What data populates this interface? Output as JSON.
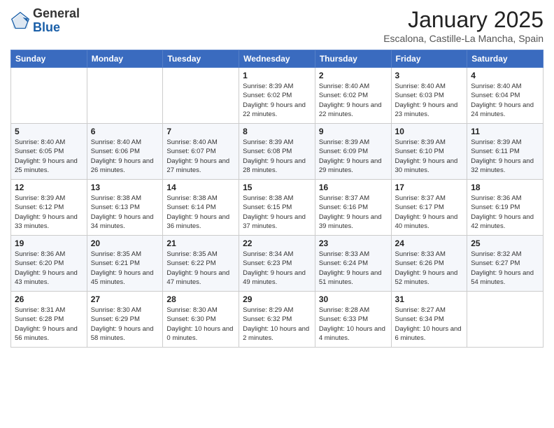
{
  "header": {
    "logo_general": "General",
    "logo_blue": "Blue",
    "month": "January 2025",
    "location": "Escalona, Castille-La Mancha, Spain"
  },
  "weekdays": [
    "Sunday",
    "Monday",
    "Tuesday",
    "Wednesday",
    "Thursday",
    "Friday",
    "Saturday"
  ],
  "weeks": [
    [
      {
        "day": "",
        "sunrise": "",
        "sunset": "",
        "daylight": ""
      },
      {
        "day": "",
        "sunrise": "",
        "sunset": "",
        "daylight": ""
      },
      {
        "day": "",
        "sunrise": "",
        "sunset": "",
        "daylight": ""
      },
      {
        "day": "1",
        "sunrise": "Sunrise: 8:39 AM",
        "sunset": "Sunset: 6:02 PM",
        "daylight": "Daylight: 9 hours and 22 minutes."
      },
      {
        "day": "2",
        "sunrise": "Sunrise: 8:40 AM",
        "sunset": "Sunset: 6:02 PM",
        "daylight": "Daylight: 9 hours and 22 minutes."
      },
      {
        "day": "3",
        "sunrise": "Sunrise: 8:40 AM",
        "sunset": "Sunset: 6:03 PM",
        "daylight": "Daylight: 9 hours and 23 minutes."
      },
      {
        "day": "4",
        "sunrise": "Sunrise: 8:40 AM",
        "sunset": "Sunset: 6:04 PM",
        "daylight": "Daylight: 9 hours and 24 minutes."
      }
    ],
    [
      {
        "day": "5",
        "sunrise": "Sunrise: 8:40 AM",
        "sunset": "Sunset: 6:05 PM",
        "daylight": "Daylight: 9 hours and 25 minutes."
      },
      {
        "day": "6",
        "sunrise": "Sunrise: 8:40 AM",
        "sunset": "Sunset: 6:06 PM",
        "daylight": "Daylight: 9 hours and 26 minutes."
      },
      {
        "day": "7",
        "sunrise": "Sunrise: 8:40 AM",
        "sunset": "Sunset: 6:07 PM",
        "daylight": "Daylight: 9 hours and 27 minutes."
      },
      {
        "day": "8",
        "sunrise": "Sunrise: 8:39 AM",
        "sunset": "Sunset: 6:08 PM",
        "daylight": "Daylight: 9 hours and 28 minutes."
      },
      {
        "day": "9",
        "sunrise": "Sunrise: 8:39 AM",
        "sunset": "Sunset: 6:09 PM",
        "daylight": "Daylight: 9 hours and 29 minutes."
      },
      {
        "day": "10",
        "sunrise": "Sunrise: 8:39 AM",
        "sunset": "Sunset: 6:10 PM",
        "daylight": "Daylight: 9 hours and 30 minutes."
      },
      {
        "day": "11",
        "sunrise": "Sunrise: 8:39 AM",
        "sunset": "Sunset: 6:11 PM",
        "daylight": "Daylight: 9 hours and 32 minutes."
      }
    ],
    [
      {
        "day": "12",
        "sunrise": "Sunrise: 8:39 AM",
        "sunset": "Sunset: 6:12 PM",
        "daylight": "Daylight: 9 hours and 33 minutes."
      },
      {
        "day": "13",
        "sunrise": "Sunrise: 8:38 AM",
        "sunset": "Sunset: 6:13 PM",
        "daylight": "Daylight: 9 hours and 34 minutes."
      },
      {
        "day": "14",
        "sunrise": "Sunrise: 8:38 AM",
        "sunset": "Sunset: 6:14 PM",
        "daylight": "Daylight: 9 hours and 36 minutes."
      },
      {
        "day": "15",
        "sunrise": "Sunrise: 8:38 AM",
        "sunset": "Sunset: 6:15 PM",
        "daylight": "Daylight: 9 hours and 37 minutes."
      },
      {
        "day": "16",
        "sunrise": "Sunrise: 8:37 AM",
        "sunset": "Sunset: 6:16 PM",
        "daylight": "Daylight: 9 hours and 39 minutes."
      },
      {
        "day": "17",
        "sunrise": "Sunrise: 8:37 AM",
        "sunset": "Sunset: 6:17 PM",
        "daylight": "Daylight: 9 hours and 40 minutes."
      },
      {
        "day": "18",
        "sunrise": "Sunrise: 8:36 AM",
        "sunset": "Sunset: 6:19 PM",
        "daylight": "Daylight: 9 hours and 42 minutes."
      }
    ],
    [
      {
        "day": "19",
        "sunrise": "Sunrise: 8:36 AM",
        "sunset": "Sunset: 6:20 PM",
        "daylight": "Daylight: 9 hours and 43 minutes."
      },
      {
        "day": "20",
        "sunrise": "Sunrise: 8:35 AM",
        "sunset": "Sunset: 6:21 PM",
        "daylight": "Daylight: 9 hours and 45 minutes."
      },
      {
        "day": "21",
        "sunrise": "Sunrise: 8:35 AM",
        "sunset": "Sunset: 6:22 PM",
        "daylight": "Daylight: 9 hours and 47 minutes."
      },
      {
        "day": "22",
        "sunrise": "Sunrise: 8:34 AM",
        "sunset": "Sunset: 6:23 PM",
        "daylight": "Daylight: 9 hours and 49 minutes."
      },
      {
        "day": "23",
        "sunrise": "Sunrise: 8:33 AM",
        "sunset": "Sunset: 6:24 PM",
        "daylight": "Daylight: 9 hours and 51 minutes."
      },
      {
        "day": "24",
        "sunrise": "Sunrise: 8:33 AM",
        "sunset": "Sunset: 6:26 PM",
        "daylight": "Daylight: 9 hours and 52 minutes."
      },
      {
        "day": "25",
        "sunrise": "Sunrise: 8:32 AM",
        "sunset": "Sunset: 6:27 PM",
        "daylight": "Daylight: 9 hours and 54 minutes."
      }
    ],
    [
      {
        "day": "26",
        "sunrise": "Sunrise: 8:31 AM",
        "sunset": "Sunset: 6:28 PM",
        "daylight": "Daylight: 9 hours and 56 minutes."
      },
      {
        "day": "27",
        "sunrise": "Sunrise: 8:30 AM",
        "sunset": "Sunset: 6:29 PM",
        "daylight": "Daylight: 9 hours and 58 minutes."
      },
      {
        "day": "28",
        "sunrise": "Sunrise: 8:30 AM",
        "sunset": "Sunset: 6:30 PM",
        "daylight": "Daylight: 10 hours and 0 minutes."
      },
      {
        "day": "29",
        "sunrise": "Sunrise: 8:29 AM",
        "sunset": "Sunset: 6:32 PM",
        "daylight": "Daylight: 10 hours and 2 minutes."
      },
      {
        "day": "30",
        "sunrise": "Sunrise: 8:28 AM",
        "sunset": "Sunset: 6:33 PM",
        "daylight": "Daylight: 10 hours and 4 minutes."
      },
      {
        "day": "31",
        "sunrise": "Sunrise: 8:27 AM",
        "sunset": "Sunset: 6:34 PM",
        "daylight": "Daylight: 10 hours and 6 minutes."
      },
      {
        "day": "",
        "sunrise": "",
        "sunset": "",
        "daylight": ""
      }
    ]
  ]
}
